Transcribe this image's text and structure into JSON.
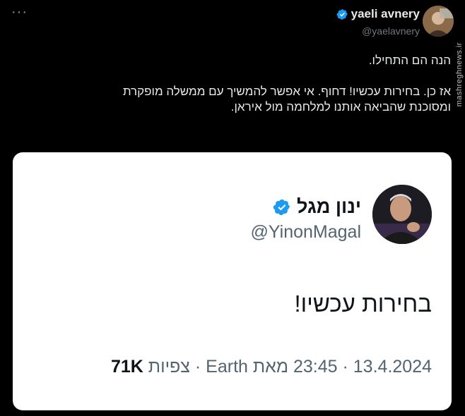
{
  "tweet": {
    "author_name": "yaeli avnery",
    "author_handle": "@yaelavnery",
    "more_label": "···",
    "lines": [
      "הנה הם התחילו.",
      "",
      "אז כן. בחירות עכשיו! דחוף. אי אפשר להמשיך עם ממשלה מופקרת",
      "ומסוכנת שהביאה אותנו למלחמה מול איראן."
    ]
  },
  "watermark": {
    "text": "mashreghnews.ir"
  },
  "quoted": {
    "author_name": "ינון מגל",
    "author_handle": "@YinonMagal",
    "text": "בחירות עכשיו!",
    "date": "13.4.2024",
    "time": "23:45",
    "source": "מאת Earth",
    "views_count": "71K",
    "views_label": "צפיות"
  },
  "colors": {
    "background": "#000000",
    "verified": "#1d9bf0",
    "card": "#ffffff"
  },
  "icons": {
    "verified": "verified-badge-icon",
    "more": "more-options-icon"
  }
}
